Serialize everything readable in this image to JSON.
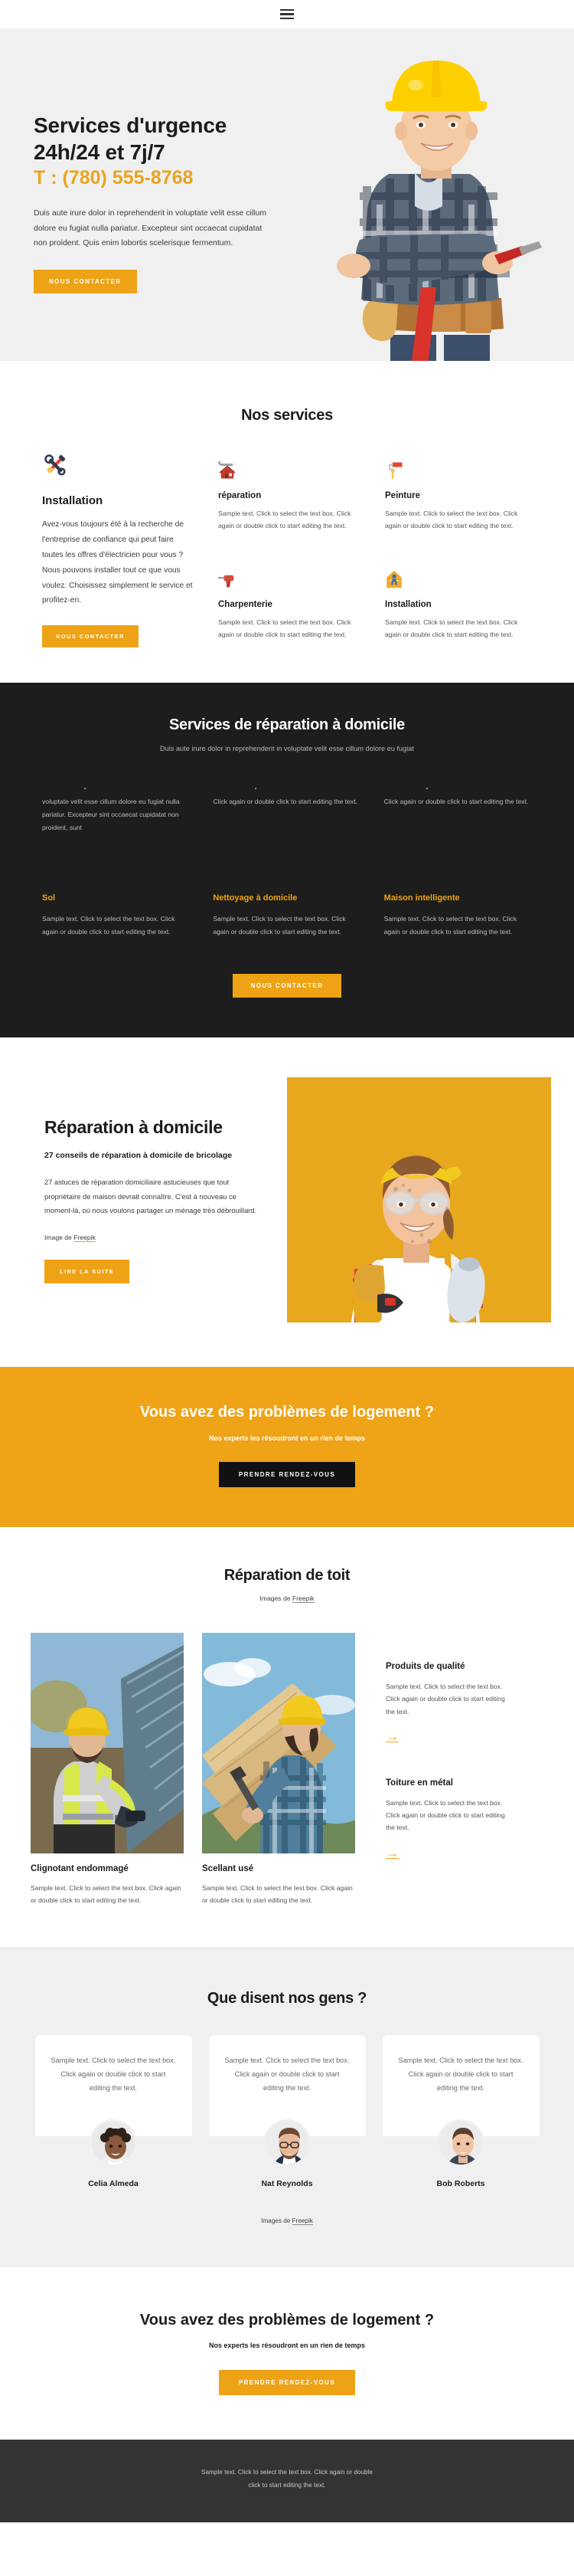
{
  "header": {
    "menu_icon": "hamburger-menu-icon"
  },
  "hero": {
    "title_line1": "Services d'urgence",
    "title_line2": "24h/24 et 7j/7",
    "phone": "T : (780) 555-8768",
    "description": "Duis aute irure dolor in reprehenderit in voluptate velit esse cillum dolore eu fugiat nulla pariatur. Excepteur sint occaecat cupidatat non proident. Quis enim lobortis scelerisque fermentum.",
    "button": "NOUS CONTACTER",
    "image_alt": "smiling-construction-worker-with-yellow-hardhat"
  },
  "services": {
    "title": "Nos services",
    "feature": {
      "icon": "crossed-tools-icon",
      "icon_glyph": "⚒",
      "title": "Installation",
      "text": "Avez-vous toujours été à la recherche de l'entreprise de confiance qui peut faire toutes les offres d'électricien pour vous ? Nous pouvons installer tout ce que vous voulez. Choisissez simplement le service et profitez-en.",
      "button": "NOUS CONTACTER"
    },
    "cards": [
      {
        "icon": "house-wrench-icon",
        "title": "réparation",
        "text": "Sample text. Click to select the text box. Click again or double click to start editing the text."
      },
      {
        "icon": "paint-roller-icon",
        "title": "Peinture",
        "text": "Sample text. Click to select the text box. Click again or double click to start editing the text."
      },
      {
        "icon": "power-drill-icon",
        "title": "Charpenterie",
        "text": "Sample text. Click to select the text box. Click again or double click to start editing the text."
      },
      {
        "icon": "worker-house-icon",
        "title": "Installation",
        "text": "Sample text. Click to select the text box. Click again or double click to start editing the text."
      }
    ]
  },
  "dark_services": {
    "title": "Services de réparation à domicile",
    "subtitle": "Duis aute irure dolor in reprehenderit in voluptate velit esse cillum dolore eu fugiat",
    "columns": [
      {
        "lead": "voluptate velit esse cillum dolore eu fugiat nulla pariatur. Excepteur sint occaecat cupidatat non proident, sunt",
        "title": "Sol",
        "text": "Sample text. Click to select the text box. Click again or double click to start editing the text."
      },
      {
        "lead": "Click again or double click to start editing the text.",
        "title": "Nettoyage à domicile",
        "text": "Sample text. Click to select the text box. Click again or double click to start editing the text."
      },
      {
        "lead": "Click again or double click to start editing the text.",
        "title": "Maison intelligente",
        "text": "Sample text. Click to select the text box. Click again or double click to start editing the text."
      }
    ],
    "button": "NOUS CONTACTER"
  },
  "repair": {
    "title": "Réparation à domicile",
    "subtitle": "27 conseils de réparation à domicile de bricolage",
    "text": "27 astuces de réparation domiciliaire astucieuses que tout propriétaire de maison devrait connaître. C'est à nouveau ce moment-là, où nous voulons partager un ménage très débrouillard.",
    "credit_prefix": "Image de ",
    "credit_link": "Freepik",
    "button": "LIRE LA SUITE",
    "image_alt": "smiling-woman-with-safety-goggles-and-drill-on-yellow-background"
  },
  "cta_amber": {
    "title": "Vous avez des problèmes de logement ?",
    "subtitle": "Nos experts les résoudront en un rien de temps",
    "button": "PRENDRE RENDEZ-VOUS"
  },
  "roof": {
    "title": "Réparation de toit",
    "credit_prefix": "Images de ",
    "credit_link": "Freepik",
    "cards": [
      {
        "title": "Clignotant endommagé",
        "text": "Sample text. Click to select the text box. Click again or double click to start editing the text.",
        "image_alt": "roofer-in-safety-vest-drilling-metal-roof"
      },
      {
        "title": "Scellant usé",
        "text": "Sample text. Click to select the text box. Click again or double click to start editing the text.",
        "image_alt": "roofer-in-plaid-shirt-hammering-wooden-roof-beam"
      }
    ],
    "side": [
      {
        "title": "Produits de qualité",
        "text": "Sample text. Click to select the text box. Click again or double click to start editing the text.",
        "arrow": "→"
      },
      {
        "title": "Toiture en métal",
        "text": "Sample text. Click to select the text box. Click again or double click to start editing the text.",
        "arrow": "→"
      }
    ]
  },
  "testimonials": {
    "title": "Que disent nos gens ?",
    "items": [
      {
        "quote": "Sample text. Click to select the text box. Click again or double click to start editing the text.",
        "name": "Celia Almeda",
        "avatar_alt": "portrait-of-smiling-woman-with-curly-hair"
      },
      {
        "quote": "Sample text. Click to select the text box. Click again or double click to start editing the text.",
        "name": "Nat Reynolds",
        "avatar_alt": "portrait-of-man-with-glasses-and-beard"
      },
      {
        "quote": "Sample text. Click to select the text box. Click again or double click to start editing the text.",
        "name": "Bob Roberts",
        "avatar_alt": "portrait-of-young-man-in-dark-shirt"
      }
    ],
    "credit_prefix": "Images de ",
    "credit_link": "Freepik"
  },
  "cta_white": {
    "title": "Vous avez des problèmes de logement ?",
    "subtitle": "Nos experts les résoudront en un rien de temps",
    "button": "PRENDRE RENDEZ-VOUS"
  },
  "footer": {
    "line1": "Sample text. Click to select the text box. Click again or double",
    "line2": "click to start editing the text."
  },
  "colors": {
    "amber": "#eda315",
    "dark": "#1d1d1d",
    "footer_dark": "#333333",
    "light_gray": "#f0f0f0"
  }
}
